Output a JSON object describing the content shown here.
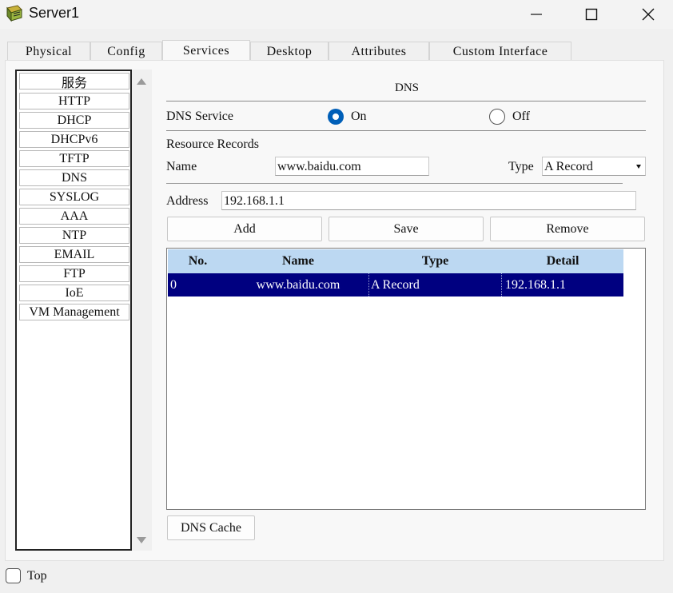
{
  "window": {
    "title": "Server1"
  },
  "tabs": [
    "Physical",
    "Config",
    "Services",
    "Desktop",
    "Attributes",
    "Custom Interface"
  ],
  "active_tab": "Services",
  "services": [
    "服务",
    "HTTP",
    "DHCP",
    "DHCPv6",
    "TFTP",
    "DNS",
    "SYSLOG",
    "AAA",
    "NTP",
    "EMAIL",
    "FTP",
    "IoE",
    "VM Management"
  ],
  "dns": {
    "section_title": "DNS",
    "service_label": "DNS Service",
    "on_label": "On",
    "off_label": "Off",
    "service_state": "On",
    "resource_records_label": "Resource Records",
    "name_label": "Name",
    "name_value": "www.baidu.com",
    "type_label": "Type",
    "type_value": "A Record",
    "address_label": "Address",
    "address_value": "192.168.1.1",
    "add_button": "Add",
    "save_button": "Save",
    "remove_button": "Remove",
    "dns_cache_button": "DNS Cache"
  },
  "table": {
    "headers": [
      "No.",
      "Name",
      "Type",
      "Detail"
    ],
    "rows": [
      {
        "no": "0",
        "name": "www.baidu.com",
        "type": "A Record",
        "detail": "192.168.1.1"
      }
    ]
  },
  "footer": {
    "top_label": "Top",
    "top_checked": false
  },
  "colors": {
    "selection": "#000080",
    "header": "#bcd8f2",
    "radio": "#005fb8"
  }
}
